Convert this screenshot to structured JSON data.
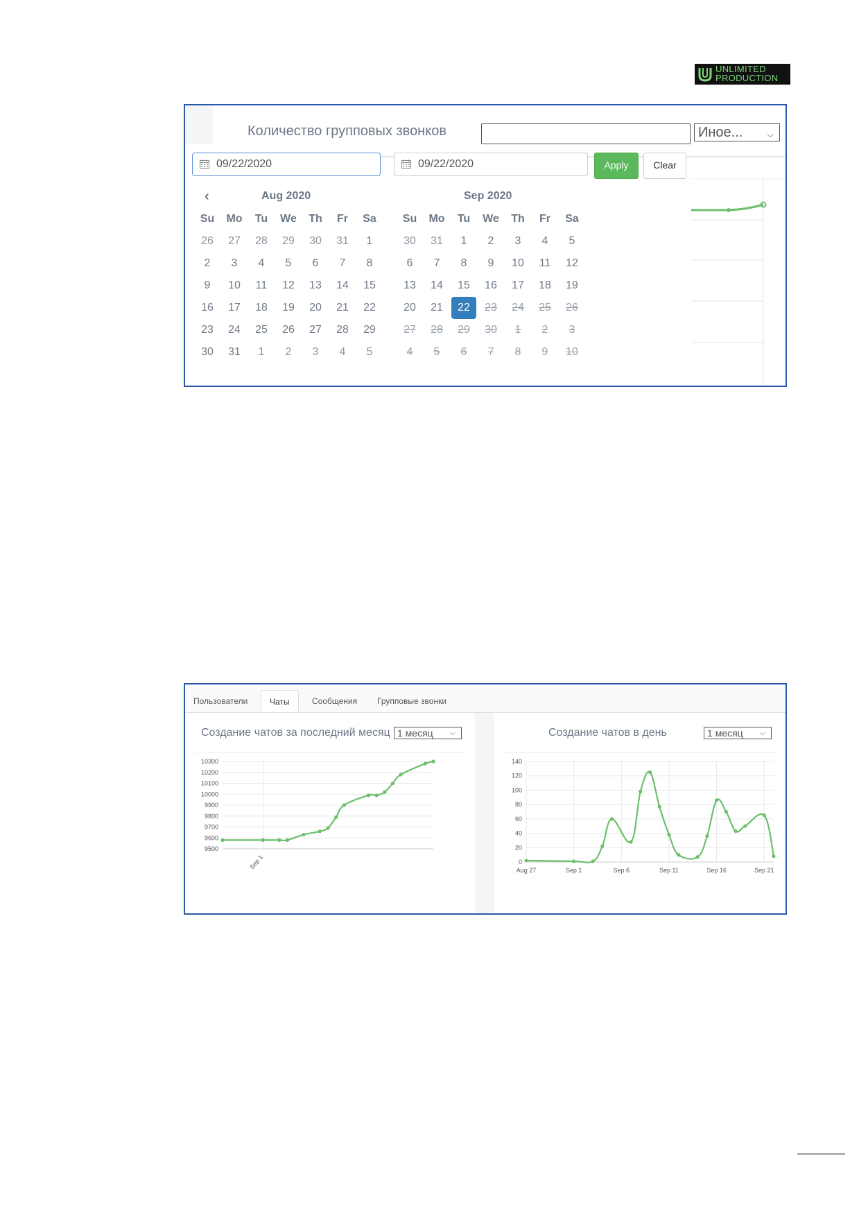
{
  "logo": {
    "line1": "UNLIMITED",
    "line2": "PRODUCTION"
  },
  "screenshot1": {
    "title": "Количество групповых звонков",
    "select_value": "Иное...",
    "start_date": "09/22/2020",
    "end_date": "09/22/2020",
    "apply_label": "Apply",
    "clear_label": "Clear",
    "weekdays": [
      "Su",
      "Mo",
      "Tu",
      "We",
      "Th",
      "Fr",
      "Sa"
    ],
    "left_calendar": {
      "month": "Aug 2020",
      "rows": [
        [
          "26",
          "27",
          "28",
          "29",
          "30",
          "31",
          "1"
        ],
        [
          "2",
          "3",
          "4",
          "5",
          "6",
          "7",
          "8"
        ],
        [
          "9",
          "10",
          "11",
          "12",
          "13",
          "14",
          "15"
        ],
        [
          "16",
          "17",
          "18",
          "19",
          "20",
          "21",
          "22"
        ],
        [
          "23",
          "24",
          "25",
          "26",
          "27",
          "28",
          "29"
        ],
        [
          "30",
          "31",
          "1",
          "2",
          "3",
          "4",
          "5"
        ]
      ]
    },
    "right_calendar": {
      "month": "Sep 2020",
      "selected": "22",
      "rows": [
        [
          "30",
          "31",
          "1",
          "2",
          "3",
          "4",
          "5"
        ],
        [
          "6",
          "7",
          "8",
          "9",
          "10",
          "11",
          "12"
        ],
        [
          "13",
          "14",
          "15",
          "16",
          "17",
          "18",
          "19"
        ],
        [
          "20",
          "21",
          "22",
          "23",
          "24",
          "25",
          "26"
        ],
        [
          "27",
          "28",
          "29",
          "30",
          "1",
          "2",
          "3"
        ],
        [
          "4",
          "5",
          "6",
          "7",
          "8",
          "9",
          "10"
        ]
      ]
    }
  },
  "screenshot2": {
    "tabs": [
      "Пользователи",
      "Чаты",
      "Сообщения",
      "Групповые звонки"
    ],
    "active_tab": "Чаты",
    "left_panel": {
      "title": "Создание чатов за последний месяц",
      "select_value": "1 месяц"
    },
    "right_panel": {
      "title": "Создание чатов в день",
      "select_value": "1 месяц"
    }
  },
  "chart_data": [
    {
      "type": "line",
      "title": "",
      "xlabel": "",
      "ylabel": "",
      "x_ticks": [
        "Sep 1"
      ],
      "y_ticks": [
        "9500",
        "9600",
        "9700",
        "9800",
        "9900",
        "10000",
        "10100",
        "10200",
        "10300"
      ],
      "ylim": [
        9500,
        10300
      ],
      "x_index_range": [
        0,
        26
      ],
      "x_tick_index": [
        5
      ],
      "x": [
        0,
        5,
        7,
        8,
        10,
        12,
        13,
        14,
        15,
        18,
        19,
        20,
        21,
        22,
        25,
        26
      ],
      "values": [
        9580,
        9580,
        9580,
        9580,
        9630,
        9660,
        9690,
        9790,
        9900,
        9990,
        9990,
        10020,
        10100,
        10180,
        10280,
        10300
      ],
      "color": "#6cbf6c"
    },
    {
      "type": "line",
      "title": "",
      "xlabel": "",
      "ylabel": "",
      "x_ticks": [
        "Aug 27",
        "Sep 1",
        "Sep 6",
        "Sep 11",
        "Sep 16",
        "Sep 21"
      ],
      "y_ticks": [
        "0",
        "20",
        "40",
        "60",
        "80",
        "100",
        "120",
        "140"
      ],
      "ylim": [
        0,
        140
      ],
      "x_index_range": [
        0,
        26
      ],
      "x_tick_index": [
        0,
        5,
        10,
        15,
        20,
        25
      ],
      "x": [
        0,
        5,
        7,
        8,
        9,
        11,
        12,
        13,
        14,
        15,
        16,
        18,
        19,
        20,
        21,
        22,
        23,
        25,
        26
      ],
      "values": [
        2,
        1,
        1,
        22,
        60,
        28,
        98,
        125,
        77,
        38,
        10,
        7,
        36,
        86,
        70,
        43,
        50,
        65,
        8
      ],
      "color": "#6cbf6c"
    }
  ]
}
